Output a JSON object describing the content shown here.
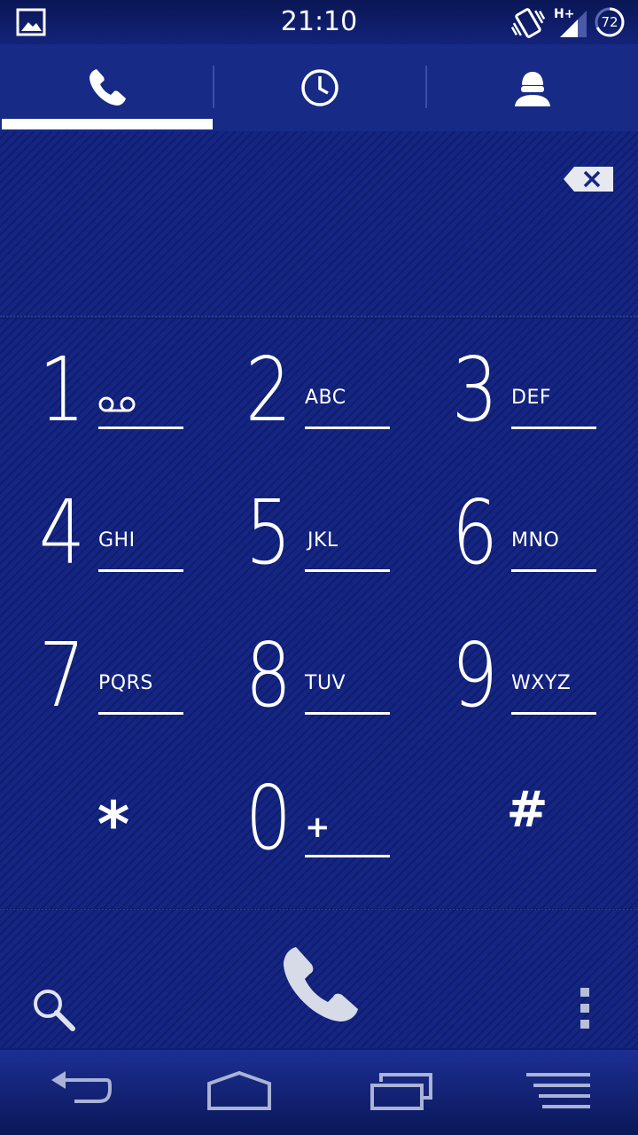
{
  "status_bar": {
    "time": "21:10",
    "battery_level": "72",
    "network_type": "H+"
  },
  "tabs": [
    {
      "name": "dialpad",
      "icon": "phone-icon",
      "active": true
    },
    {
      "name": "call-log",
      "icon": "clock-icon",
      "active": false
    },
    {
      "name": "contacts",
      "icon": "contact-icon",
      "active": false
    }
  ],
  "dialpad": {
    "number_display": "",
    "keys": [
      {
        "digit": "1",
        "letters": ""
      },
      {
        "digit": "2",
        "letters": "ABC"
      },
      {
        "digit": "3",
        "letters": "DEF"
      },
      {
        "digit": "4",
        "letters": "GHI"
      },
      {
        "digit": "5",
        "letters": "JKL"
      },
      {
        "digit": "6",
        "letters": "MNO"
      },
      {
        "digit": "7",
        "letters": "PQRS"
      },
      {
        "digit": "8",
        "letters": "TUV"
      },
      {
        "digit": "9",
        "letters": "WXYZ"
      },
      {
        "digit": "*",
        "letters": ""
      },
      {
        "digit": "0",
        "letters": "+"
      },
      {
        "digit": "#",
        "letters": ""
      }
    ]
  },
  "colors": {
    "background": "#142583",
    "tab_bar": "#162a86",
    "foreground": "#ffffff",
    "call_icon": "#d7dbe8"
  }
}
